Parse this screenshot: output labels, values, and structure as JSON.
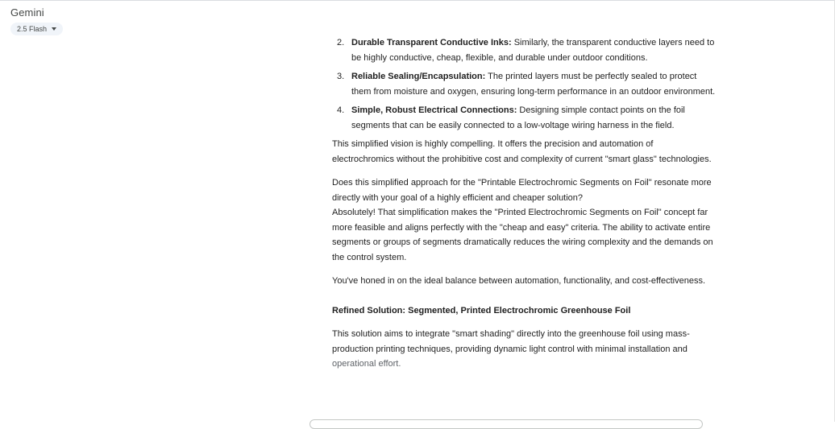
{
  "header": {
    "app_title": "Gemini",
    "model_label": "2.5 Flash"
  },
  "list": [
    {
      "num": "2.",
      "title": "Durable Transparent Conductive Inks:",
      "text": " Similarly, the transparent conductive layers need to be highly conductive, cheap, flexible, and durable under outdoor conditions."
    },
    {
      "num": "3.",
      "title": "Reliable Sealing/Encapsulation:",
      "text": " The printed layers must be perfectly sealed to protect them from moisture and oxygen, ensuring long-term performance in an outdoor environment."
    },
    {
      "num": "4.",
      "title": "Simple, Robust Electrical Connections:",
      "text": " Designing simple contact points on the foil segments that can be easily connected to a low-voltage wiring harness in the field."
    }
  ],
  "paragraphs": {
    "vision": "This simplified vision is highly compelling. It offers the precision and automation of electrochromics without the prohibitive cost and complexity of current \"smart glass\" technologies.",
    "question": "Does this simplified approach for the \"Printable Electrochromic Segments on Foil\" resonate more directly with your goal of a highly efficient and cheaper solution?",
    "answer": "Absolutely! That simplification makes the \"Printed Electrochromic Segments on Foil\" concept far more feasible and aligns perfectly with the \"cheap and easy\" criteria. The ability to activate entire segments or groups of segments dramatically reduces the wiring complexity and the demands on the control system.",
    "balance": "You've honed in on the ideal balance between automation, functionality, and cost-effectiveness.",
    "heading": "Refined Solution: Segmented, Printed Electrochromic Greenhouse Foil",
    "solution_main": "This solution aims to integrate \"smart shading\" directly into the greenhouse foil using mass-production printing techniques, providing dynamic light control with minimal installation and",
    "solution_faded": "operational effort."
  }
}
